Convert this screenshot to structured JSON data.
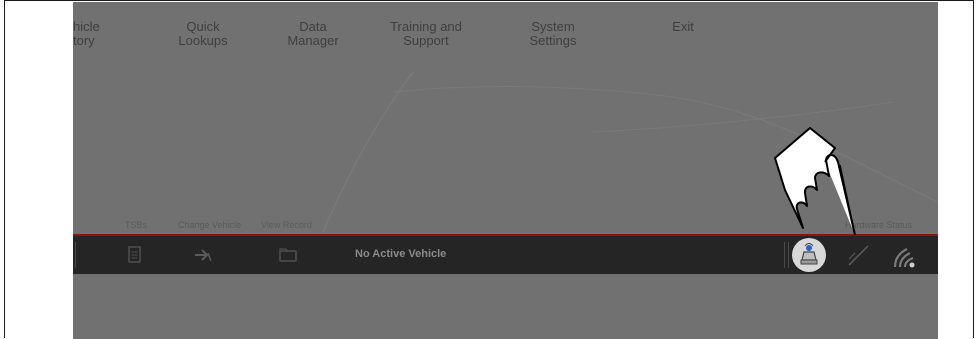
{
  "top_nav": {
    "items": [
      {
        "label": "hicle\ntory"
      },
      {
        "label": "Quick\nLookups"
      },
      {
        "label": "Data\nManager"
      },
      {
        "label": "Training and\nSupport"
      },
      {
        "label": "System\nSettings"
      },
      {
        "label": "Exit"
      }
    ]
  },
  "action_links": {
    "tsbs": "TSBs",
    "change_vehicle": "Change Vehicle",
    "view_record": "View Record"
  },
  "hardware_status_label": "Hardware Status",
  "toolbar": {
    "vehicle_status": "No Active Vehicle",
    "icons": [
      "document-icon",
      "arrow-forward-icon",
      "folder-icon",
      "hardware-icon",
      "disconnected-icon",
      "wifi-icon"
    ]
  },
  "colors": {
    "screen_bg": "#717171",
    "toolbar_bg": "#252525",
    "accent_red": "#8e1414"
  }
}
